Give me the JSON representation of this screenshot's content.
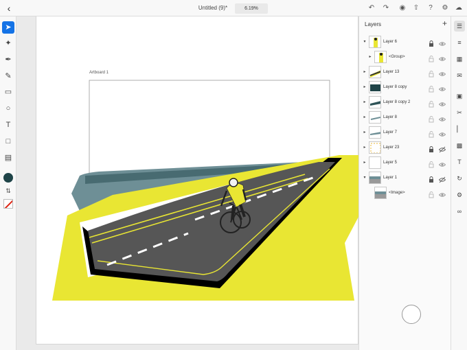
{
  "header": {
    "title": "Untitled (9)*",
    "zoom": "6.19%",
    "icons": [
      "chevron-left-icon",
      "undo-icon",
      "redo-icon",
      "user-icon",
      "share-icon",
      "help-icon",
      "settings-icon",
      "cloud-icon"
    ]
  },
  "left_toolbar": {
    "tools": [
      "selection-icon",
      "direct-selection-icon",
      "pen-icon",
      "pencil-icon",
      "eraser-icon",
      "shape-icon",
      "type-icon",
      "transform-icon",
      "image-icon"
    ],
    "fill_color": "#1f4448",
    "swap_glyph": "⇅"
  },
  "canvas": {
    "artboard_label": "Artboard 1"
  },
  "layers": {
    "title": "Layers",
    "add_glyph": "+",
    "items": [
      {
        "name": "Layer 6",
        "expanded": true,
        "locked": true,
        "visible": true,
        "child": false
      },
      {
        "name": "<Group>",
        "expanded": false,
        "locked": false,
        "visible": true,
        "child": true
      },
      {
        "name": "Layer 13",
        "expanded": false,
        "locked": false,
        "visible": true,
        "child": false
      },
      {
        "name": "Layer 8 copy",
        "expanded": false,
        "locked": false,
        "visible": true,
        "child": false
      },
      {
        "name": "Layer 8 copy 2",
        "expanded": false,
        "locked": false,
        "visible": true,
        "child": false
      },
      {
        "name": "Layer 8",
        "expanded": false,
        "locked": false,
        "visible": true,
        "child": false
      },
      {
        "name": "Layer 7",
        "expanded": false,
        "locked": false,
        "visible": true,
        "child": false
      },
      {
        "name": "Layer 23",
        "expanded": false,
        "locked": true,
        "visible": false,
        "child": false
      },
      {
        "name": "Layer 5",
        "expanded": false,
        "locked": false,
        "visible": true,
        "child": false
      },
      {
        "name": "Layer 1",
        "expanded": true,
        "locked": true,
        "visible": false,
        "child": false
      },
      {
        "name": "<Image>",
        "expanded": false,
        "locked": false,
        "visible": true,
        "child": true
      }
    ]
  },
  "right_panel": {
    "icons": [
      "layers-icon",
      "properties-icon",
      "libraries-icon",
      "comments-icon",
      "pathfinder-icon",
      "scissors-icon",
      "align-icon",
      "crop-icon",
      "type-panel-icon",
      "shape-builder-icon",
      "gear-panel-icon",
      "link-icon"
    ]
  },
  "colors": {
    "accent": "#1473e6",
    "road_yellow": "#e9e633",
    "road_asphalt": "#555555",
    "water": "#6e8f96"
  }
}
